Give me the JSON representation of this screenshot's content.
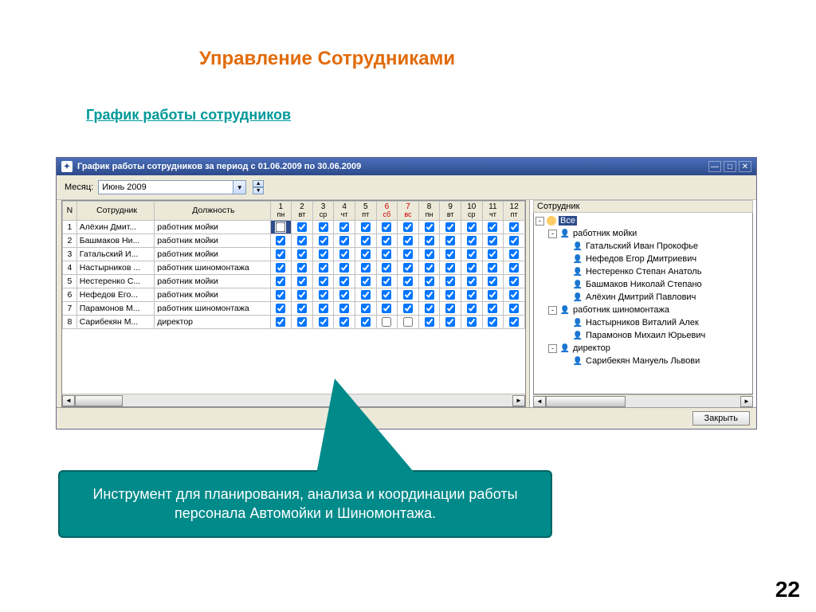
{
  "slide": {
    "title": "Управление Сотрудниками",
    "subtitle": "График работы сотрудников",
    "page": "22",
    "callout": "Инструмент для планирования, анализа и координации работы персонала Автомойки и Шиномонтажа."
  },
  "window": {
    "title": "График работы сотрудников за период с 01.06.2009 по 30.06.2009",
    "month_label": "Месяц:",
    "month_value": "Июнь 2009",
    "close_btn": "Закрыть"
  },
  "columns": {
    "num": "N",
    "employee": "Сотрудник",
    "position": "Должность",
    "tree_head": "Сотрудник"
  },
  "days": [
    {
      "n": "1",
      "w": "пн",
      "we": false
    },
    {
      "n": "2",
      "w": "вт",
      "we": false
    },
    {
      "n": "3",
      "w": "ср",
      "we": false
    },
    {
      "n": "4",
      "w": "чт",
      "we": false
    },
    {
      "n": "5",
      "w": "пт",
      "we": false
    },
    {
      "n": "6",
      "w": "сб",
      "we": true
    },
    {
      "n": "7",
      "w": "вс",
      "we": true
    },
    {
      "n": "8",
      "w": "пн",
      "we": false
    },
    {
      "n": "9",
      "w": "вт",
      "we": false
    },
    {
      "n": "10",
      "w": "ср",
      "we": false
    },
    {
      "n": "11",
      "w": "чт",
      "we": false
    },
    {
      "n": "12",
      "w": "пт",
      "we": false
    }
  ],
  "rows": [
    {
      "n": "1",
      "emp": "Алёхин Дмит...",
      "pos": "работник мойки",
      "d": [
        false,
        true,
        true,
        true,
        true,
        true,
        true,
        true,
        true,
        true,
        true,
        true
      ]
    },
    {
      "n": "2",
      "emp": "Башмаков Ни...",
      "pos": "работник мойки",
      "d": [
        true,
        true,
        true,
        true,
        true,
        true,
        true,
        true,
        true,
        true,
        true,
        true
      ]
    },
    {
      "n": "3",
      "emp": "Гатальский И...",
      "pos": "работник мойки",
      "d": [
        true,
        true,
        true,
        true,
        true,
        true,
        true,
        true,
        true,
        true,
        true,
        true
      ]
    },
    {
      "n": "4",
      "emp": "Настырников ...",
      "pos": "работник шиномонтажа",
      "d": [
        true,
        true,
        true,
        true,
        true,
        true,
        true,
        true,
        true,
        true,
        true,
        true
      ]
    },
    {
      "n": "5",
      "emp": "Нестеренко С...",
      "pos": "работник мойки",
      "d": [
        true,
        true,
        true,
        true,
        true,
        true,
        true,
        true,
        true,
        true,
        true,
        true
      ]
    },
    {
      "n": "6",
      "emp": "Нефедов Его...",
      "pos": "работник мойки",
      "d": [
        true,
        true,
        true,
        true,
        true,
        true,
        true,
        true,
        true,
        true,
        true,
        true
      ]
    },
    {
      "n": "7",
      "emp": "Парамонов М...",
      "pos": "работник шиномонтажа",
      "d": [
        true,
        true,
        true,
        true,
        true,
        true,
        true,
        true,
        true,
        true,
        true,
        true
      ]
    },
    {
      "n": "8",
      "emp": "Сарибекян М...",
      "pos": "директор",
      "d": [
        true,
        true,
        true,
        true,
        true,
        false,
        false,
        true,
        true,
        true,
        true,
        true
      ]
    }
  ],
  "tree": {
    "all": "Все",
    "groups": [
      {
        "name": "работник мойки",
        "items": [
          "Гатальский Иван Прокофье",
          "Нефедов Егор Дмитриевич",
          "Нестеренко Степан Анатоль",
          "Башмаков Николай Степано",
          "Алёхин Дмитрий Павлович"
        ]
      },
      {
        "name": "работник шиномонтажа",
        "items": [
          "Настырников Виталий Алек",
          "Парамонов Михаил Юрьевич"
        ]
      },
      {
        "name": "директор",
        "items": [
          "Сарибекян Мануель Львови"
        ]
      }
    ]
  }
}
